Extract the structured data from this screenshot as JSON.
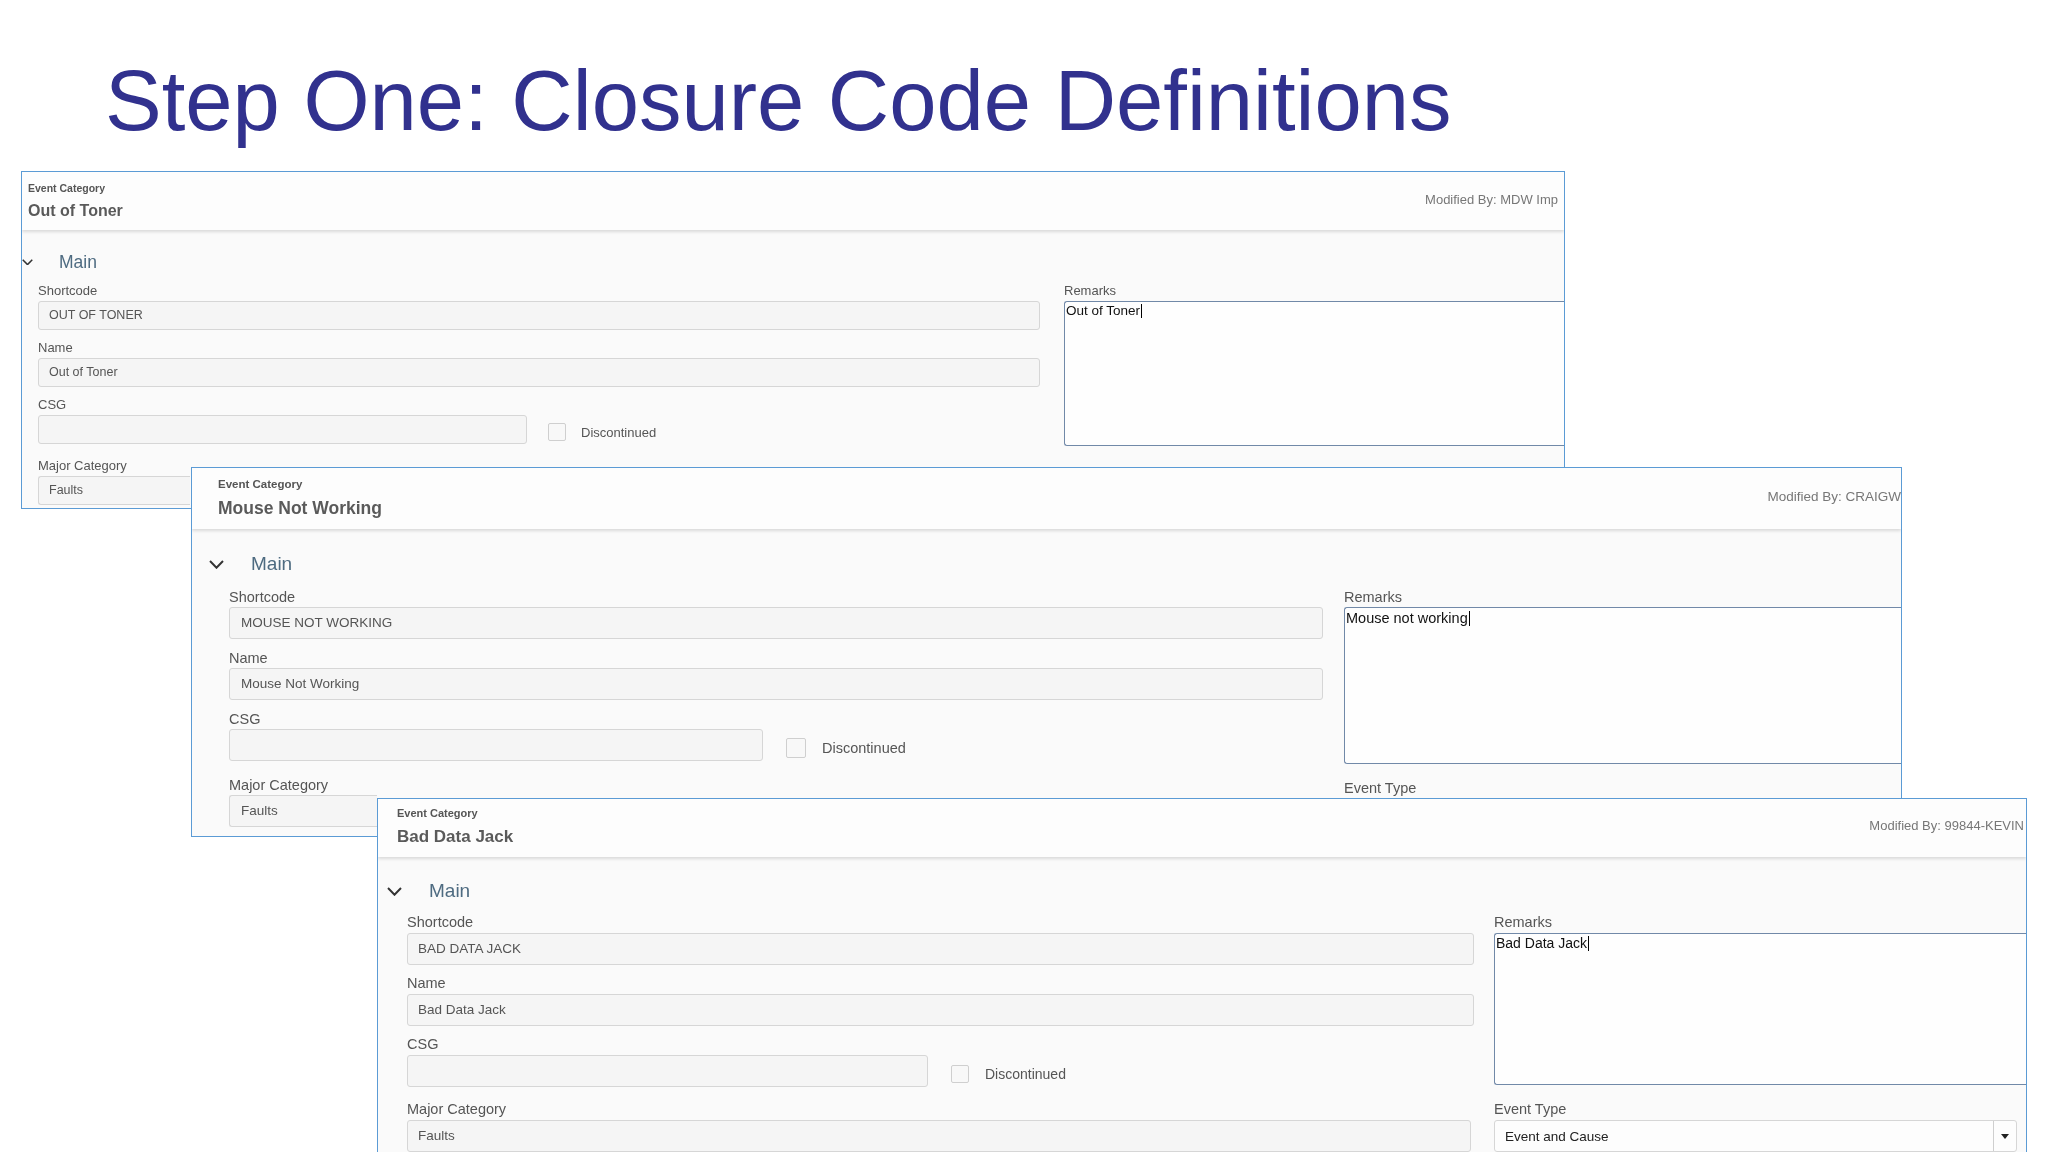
{
  "slide_title": "Step One: Closure Code Definitions",
  "panels": [
    {
      "header_label": "Event Category",
      "title": "Out of Toner",
      "modified_by": "Modified By: MDW Imp",
      "section": {
        "label": "Main",
        "expanded": true
      },
      "shortcode": {
        "label": "Shortcode",
        "value": "OUT OF TONER"
      },
      "name": {
        "label": "Name",
        "value": "Out of Toner"
      },
      "csg": {
        "label": "CSG"
      },
      "discontinued": {
        "label": "Discontinued",
        "checked": false
      },
      "major_category": {
        "label": "Major Category",
        "value": "Faults"
      },
      "remarks": {
        "label": "Remarks",
        "value": "Out of Toner",
        "focused": true
      }
    },
    {
      "header_label": "Event Category",
      "title": "Mouse Not Working",
      "modified_by": "Modified By: CRAIGW",
      "section": {
        "label": "Main",
        "expanded": true
      },
      "shortcode": {
        "label": "Shortcode",
        "value": "MOUSE NOT WORKING"
      },
      "name": {
        "label": "Name",
        "value": "Mouse Not Working"
      },
      "csg": {
        "label": "CSG"
      },
      "discontinued": {
        "label": "Discontinued",
        "checked": false
      },
      "major_category": {
        "label": "Major Category",
        "value": "Faults"
      },
      "remarks": {
        "label": "Remarks",
        "value": "Mouse not working",
        "focused": true
      },
      "event_type": {
        "label": "Event Type"
      }
    },
    {
      "header_label": "Event Category",
      "title": "Bad Data Jack",
      "modified_by": "Modified By: 99844-KEVIN",
      "section": {
        "label": "Main",
        "expanded": true
      },
      "shortcode": {
        "label": "Shortcode",
        "value": "BAD DATA JACK"
      },
      "name": {
        "label": "Name",
        "value": "Bad Data Jack"
      },
      "csg": {
        "label": "CSG"
      },
      "discontinued": {
        "label": "Discontinued",
        "checked": false
      },
      "major_category": {
        "label": "Major Category",
        "value": "Faults"
      },
      "remarks": {
        "label": "Remarks",
        "value": "Bad Data Jack",
        "focused": true
      },
      "event_type": {
        "label": "Event Type",
        "value": "Event and Cause"
      }
    }
  ]
}
